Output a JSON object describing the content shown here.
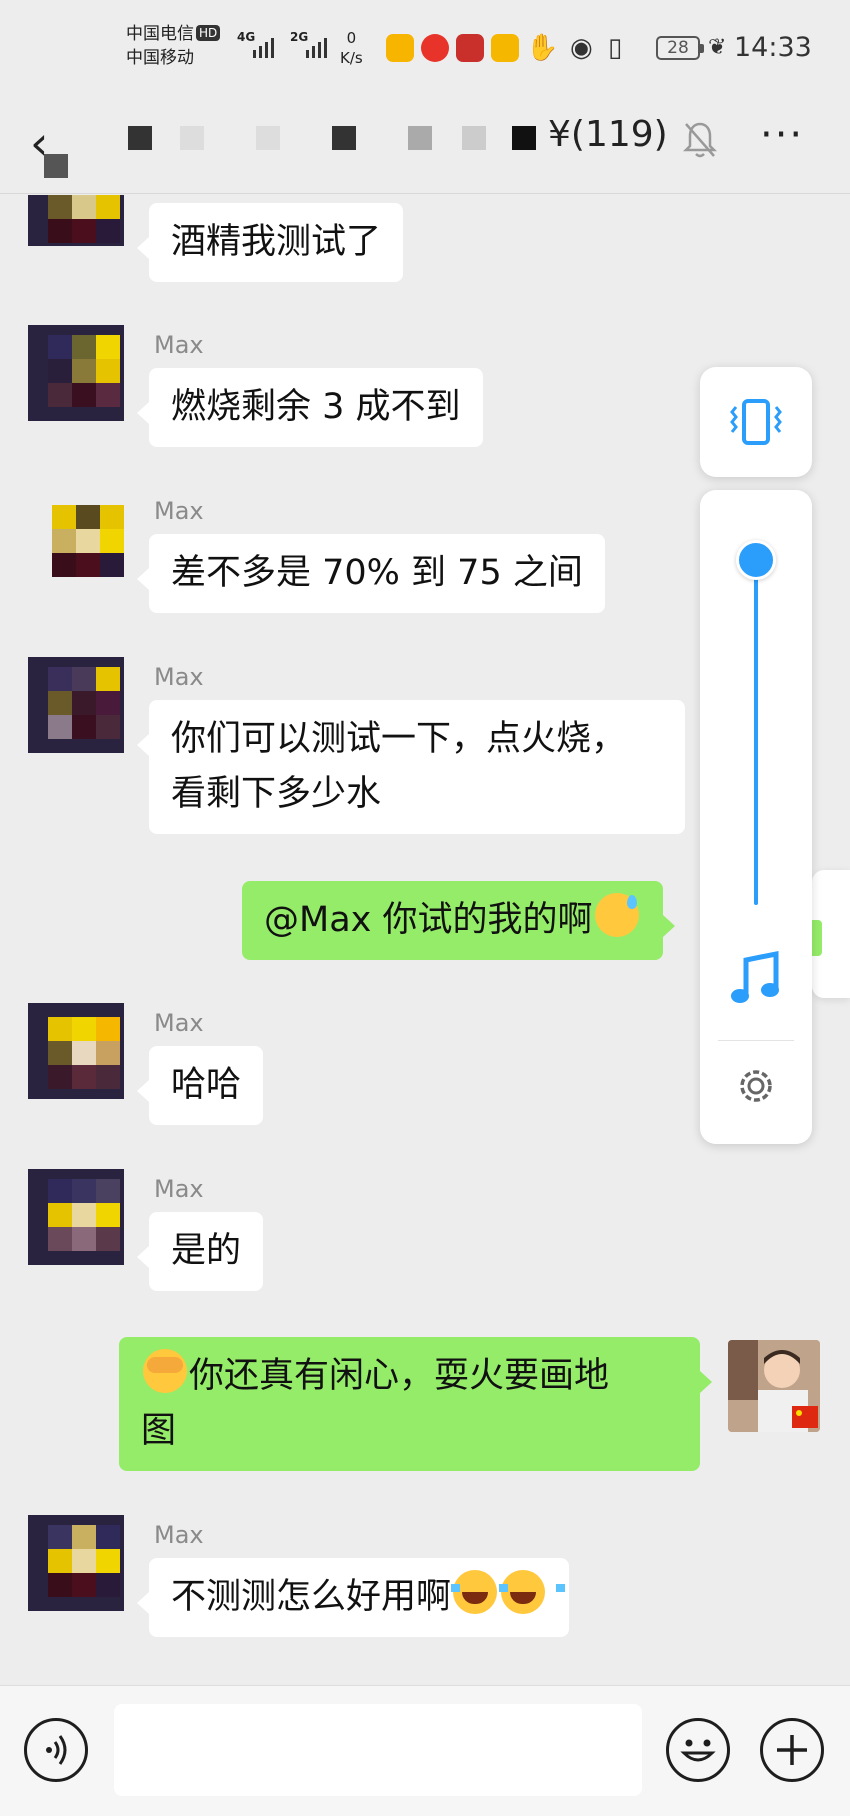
{
  "status_bar": {
    "carrier_1": "中国电信",
    "hd_badge": "HD",
    "carrier_2": "中国移动",
    "signal_1_gen": "4G",
    "signal_2_gen": "2G",
    "net_speed_value": "0",
    "net_speed_unit": "K/s",
    "battery": "28",
    "time": "14:33",
    "icons": [
      "meituan-app-icon",
      "alipay-app-icon",
      "red-app-icon",
      "mail-app-icon",
      "hand-icon",
      "eye-icon",
      "vibrate-icon",
      "battery-icon",
      "leaf-icon"
    ]
  },
  "nav": {
    "back_icon": "back-arrow-icon",
    "title_suffix": "¥(119)",
    "mute_icon": "bell-muted-icon",
    "more_icon": "more-icon",
    "more_label": "···"
  },
  "messages": [
    {
      "direction": "in",
      "sender": "",
      "text": "酒精我测试了"
    },
    {
      "direction": "in",
      "sender": "Max",
      "text": "燃烧剩余 3 成不到"
    },
    {
      "direction": "in",
      "sender": "Max",
      "text": "差不多是 70% 到 75 之间"
    },
    {
      "direction": "in",
      "sender": "Max",
      "text_line1": "你们可以测试一下，点火烧，",
      "text_line2": "看剩下多少水"
    },
    {
      "direction": "out",
      "text": "@Max  你试的我的啊",
      "emoji": "sweat-face-emoji"
    },
    {
      "direction": "in",
      "sender": "Max",
      "text": "哈哈"
    },
    {
      "direction": "in",
      "sender": "Max",
      "text": "是的"
    },
    {
      "direction": "out",
      "emoji": "face-covering-emoji",
      "text_line1": "你还真有闲心，耍火要画地",
      "text_line2": "图"
    },
    {
      "direction": "in",
      "sender": "Max",
      "text": "不测测怎么好用啊",
      "emoji": "tears-of-joy-emoji"
    }
  ],
  "volume_panel": {
    "level_percent": 100,
    "accent": "#2b9dfb",
    "icons": [
      "vibrate-mode-icon",
      "music-note-icon",
      "settings-gear-icon"
    ]
  },
  "input_bar": {
    "voice_icon": "voice-icon",
    "emoji_icon": "emoji-icon",
    "plus_icon": "plus-icon",
    "placeholder": ""
  },
  "colors": {
    "background": "#ededed",
    "incoming_bubble": "#ffffff",
    "outgoing_bubble": "#95ec69",
    "sender_name": "#8a8a8a"
  }
}
